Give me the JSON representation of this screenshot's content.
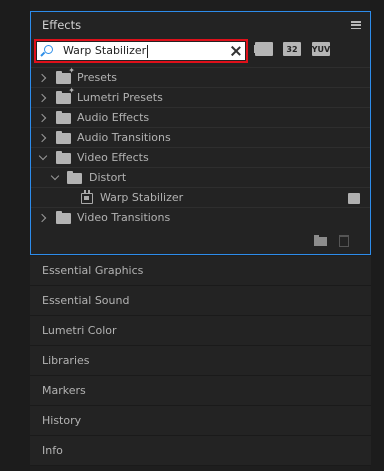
{
  "panel": {
    "title": "Effects"
  },
  "search": {
    "value": "Warp Stabilizer"
  },
  "filters": {
    "accelerated": "",
    "bit32": "32",
    "yuv": "YUV"
  },
  "tree": {
    "presets": "Presets",
    "lumetri_presets": "Lumetri Presets",
    "audio_effects": "Audio Effects",
    "audio_transitions": "Audio Transitions",
    "video_effects": "Video Effects",
    "distort": "Distort",
    "warp_stabilizer": "Warp Stabilizer",
    "video_transitions": "Video Transitions"
  },
  "collapsed_panels": [
    "Essential Graphics",
    "Essential Sound",
    "Lumetri Color",
    "Libraries",
    "Markers",
    "History",
    "Info"
  ],
  "colors": {
    "focus_border": "#2d8ceb",
    "highlight_outline": "#e0101a",
    "search_icon": "#2f8fe8"
  }
}
